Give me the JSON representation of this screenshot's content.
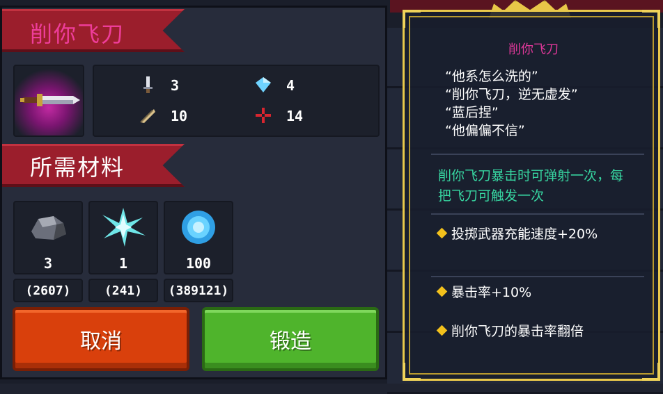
{
  "item": {
    "name": "削你飞刀",
    "stats": [
      {
        "icon": "dagger-damage-icon",
        "value": "3"
      },
      {
        "icon": "diamond-energy-icon",
        "value": "4"
      },
      {
        "icon": "feather-speed-icon",
        "value": "10"
      },
      {
        "icon": "crosshair-crit-icon",
        "value": "14"
      }
    ]
  },
  "materials": {
    "title": "所需材料",
    "items": [
      {
        "icon": "ore-icon",
        "required": "3",
        "owned": "(2607)"
      },
      {
        "icon": "crystal-shard-icon",
        "required": "1",
        "owned": "(241)"
      },
      {
        "icon": "blue-gem-icon",
        "required": "100",
        "owned": "(389121)"
      }
    ]
  },
  "buttons": {
    "cancel": "取消",
    "forge": "锻造"
  },
  "description": {
    "title": "削你飞刀",
    "quotes": [
      "“他系怎么洗的”",
      "“削你飞刀，逆无虚发”",
      "“蓝后捏”",
      "“他偏偏不信”"
    ],
    "special_effect": "削你飞刀暴击时可弹射一次，每把飞刀可触发一次",
    "bonuses": [
      "投掷武器充能速度+20%",
      "暴击率+10%",
      "削你飞刀的暴击率翻倍"
    ]
  },
  "colors": {
    "title_pink": "#e0389a",
    "effect_green": "#37d6a1",
    "gold_frame": "#e9c94b",
    "cancel_orange": "#d9400c",
    "forge_green": "#4fb42c"
  }
}
